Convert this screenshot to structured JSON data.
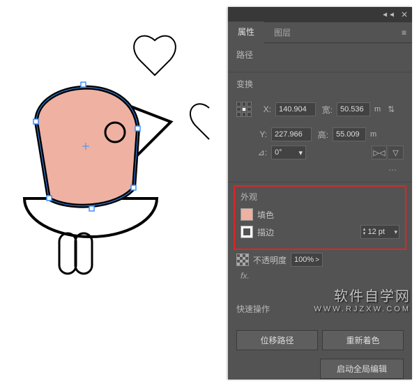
{
  "tabs": {
    "properties": "属性",
    "layers": "图层"
  },
  "section_path": "路径",
  "transform": {
    "title": "变换",
    "x_label": "X:",
    "y_label": "Y:",
    "w_label": "宽:",
    "h_label": "高:",
    "x": "140.904",
    "y": "227.966",
    "w": "50.536",
    "w_unit": "m",
    "h": "55.009",
    "h_unit": "m",
    "angle_icon": "⊿:",
    "angle": "0°"
  },
  "appearance": {
    "title": "外观",
    "fill_label": "填色",
    "stroke_label": "描边",
    "stroke_value": "12 pt",
    "opacity_label": "不透明度",
    "opacity_value": "100%",
    "fx": "fx."
  },
  "quick": {
    "title": "快速操作",
    "offset": "位移路径",
    "recolor": "重新着色",
    "global_edit": "启动全局编辑"
  },
  "watermark": {
    "zh": "软件自学网",
    "en": "WWW.RJZXW.COM"
  },
  "colors": {
    "fill_swatch": "#eeb1a2",
    "highlight_border": "#e62222"
  }
}
